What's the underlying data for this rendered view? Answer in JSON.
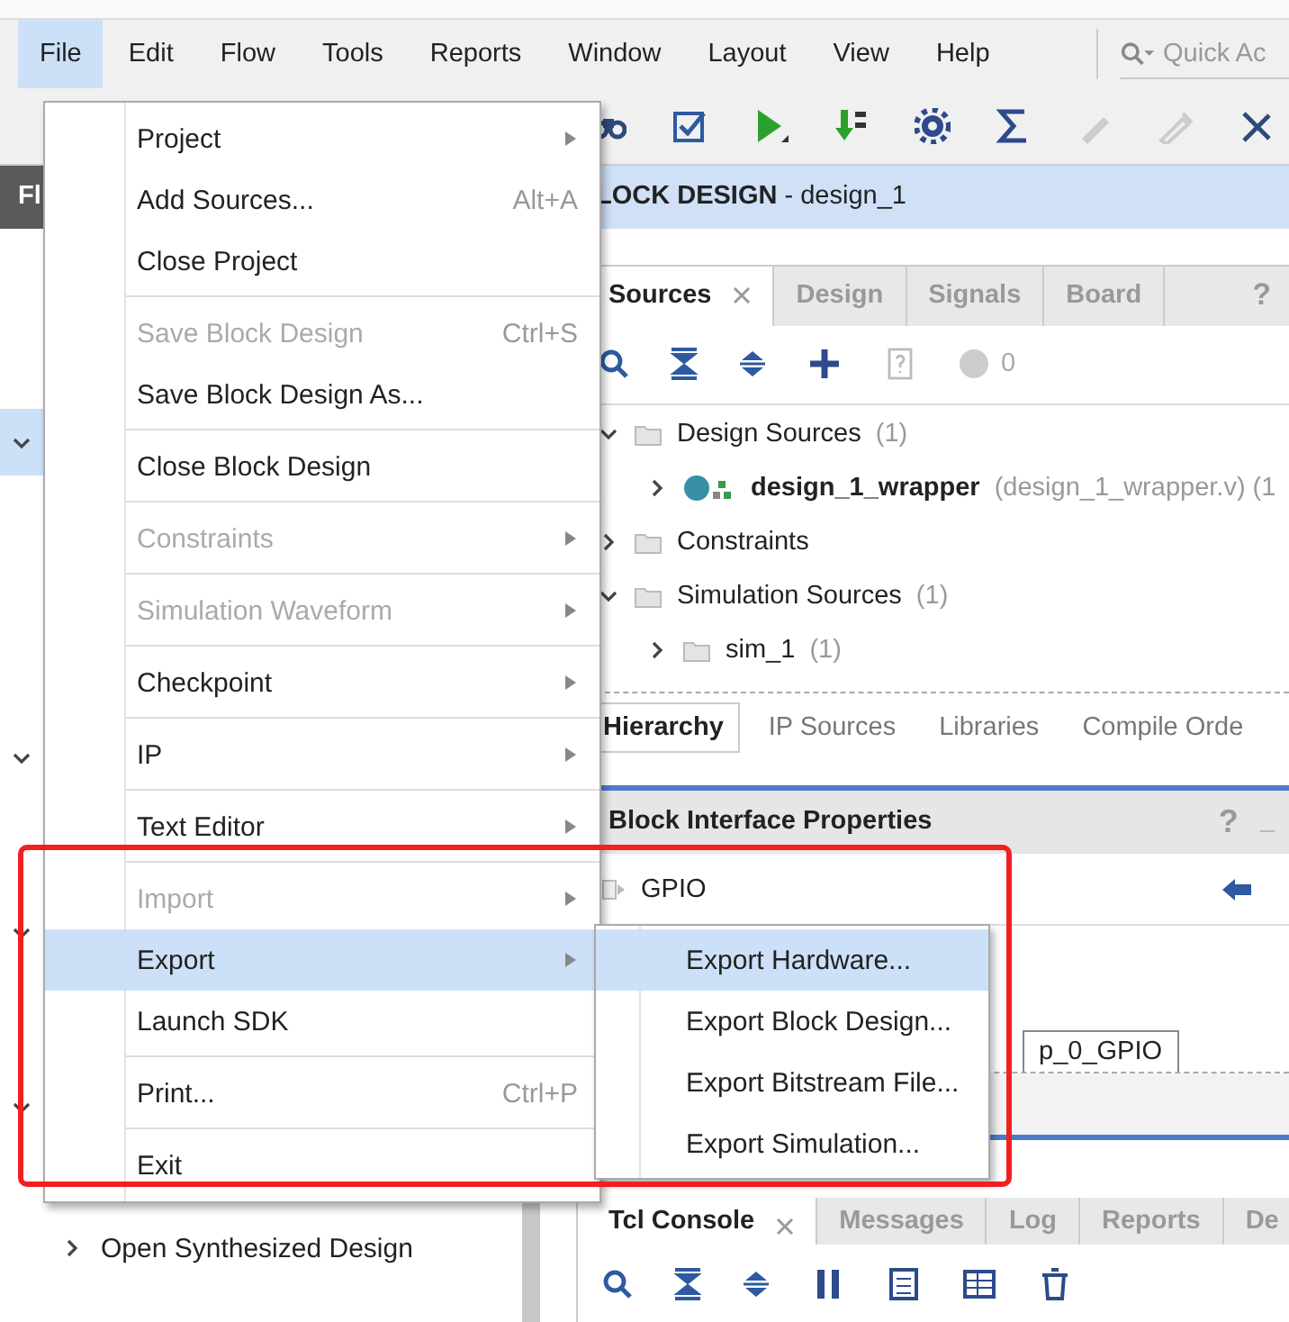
{
  "menubar": {
    "items": [
      {
        "label": "File",
        "selected": true
      },
      {
        "label": "Edit",
        "selected": false
      },
      {
        "label": "Flow",
        "selected": false
      },
      {
        "label": "Tools",
        "selected": false
      },
      {
        "label": "Reports",
        "selected": false
      },
      {
        "label": "Window",
        "selected": false
      },
      {
        "label": "Layout",
        "selected": false
      },
      {
        "label": "View",
        "selected": false
      },
      {
        "label": "Help",
        "selected": false
      }
    ],
    "quick_access": {
      "placeholder": "Quick Ac"
    }
  },
  "left_panel": {
    "header": "Fl",
    "rows": [
      {
        "selected": true
      },
      {
        "selected": false
      },
      {
        "selected": false
      },
      {
        "selected": false
      }
    ],
    "flow_item": {
      "label": "Open Synthesized Design",
      "expanded": false
    }
  },
  "diagram_header": {
    "title": "**LOCK DESIGN** - design_1"
  },
  "sources_panel": {
    "tabs": [
      {
        "label": "Sources",
        "selected": true
      },
      {
        "label": "Design",
        "selected": false
      },
      {
        "label": "Signals",
        "selected": false
      },
      {
        "label": "Board",
        "selected": false
      }
    ],
    "help": "?",
    "message_count": "0",
    "tree": [
      {
        "kind": "folder",
        "label": "Design Sources",
        "count": "(1)",
        "expanded": true,
        "children": [
          {
            "kind": "module",
            "label": "design_1_wrapper",
            "detail": "(design_1_wrapper.v) (1",
            "expanded": false
          }
        ]
      },
      {
        "kind": "folder",
        "label": "Constraints",
        "expanded": false
      },
      {
        "kind": "folder",
        "label": "Simulation Sources",
        "count": "(1)",
        "expanded": true,
        "children": [
          {
            "kind": "folder",
            "label": "sim_1",
            "count": "(1)",
            "expanded": false
          }
        ]
      }
    ],
    "bottom_tabs": [
      {
        "label": "Hierarchy",
        "selected": true
      },
      {
        "label": "IP Sources",
        "selected": false
      },
      {
        "label": "Libraries",
        "selected": false
      },
      {
        "label": "Compile Orde",
        "selected": false
      }
    ]
  },
  "properties_panel": {
    "title": "Block Interface Properties",
    "help": "?",
    "minimize": "_",
    "item": "GPIO",
    "tab": "p_0_GPIO"
  },
  "console_panel": {
    "tabs": [
      {
        "label": "Tcl Console",
        "selected": true
      },
      {
        "label": "Messages",
        "selected": false
      },
      {
        "label": "Log",
        "selected": false
      },
      {
        "label": "Reports",
        "selected": false
      },
      {
        "label": "De",
        "selected": false
      }
    ]
  },
  "file_menu": [
    {
      "kind": "item",
      "label": "Project",
      "submenu": true,
      "disabled": false,
      "selected": false
    },
    {
      "kind": "item",
      "label": "Add Sources...",
      "shortcut": "Alt+A",
      "submenu": false,
      "disabled": false,
      "selected": false
    },
    {
      "kind": "item",
      "label": "Close Project",
      "submenu": false,
      "disabled": false,
      "selected": false
    },
    {
      "kind": "separator"
    },
    {
      "kind": "item",
      "label": "Save Block Design",
      "shortcut": "Ctrl+S",
      "submenu": false,
      "disabled": true,
      "selected": false
    },
    {
      "kind": "item",
      "label": "Save Block Design As...",
      "submenu": false,
      "disabled": false,
      "selected": false
    },
    {
      "kind": "separator"
    },
    {
      "kind": "item",
      "label": "Close Block Design",
      "submenu": false,
      "disabled": false,
      "selected": false
    },
    {
      "kind": "separator"
    },
    {
      "kind": "item",
      "label": "Constraints",
      "submenu": true,
      "disabled": true,
      "selected": false
    },
    {
      "kind": "separator"
    },
    {
      "kind": "item",
      "label": "Simulation Waveform",
      "submenu": true,
      "disabled": true,
      "selected": false
    },
    {
      "kind": "separator"
    },
    {
      "kind": "item",
      "label": "Checkpoint",
      "submenu": true,
      "disabled": false,
      "selected": false
    },
    {
      "kind": "separator"
    },
    {
      "kind": "item",
      "label": "IP",
      "submenu": true,
      "disabled": false,
      "selected": false
    },
    {
      "kind": "separator"
    },
    {
      "kind": "item",
      "label": "Text Editor",
      "submenu": true,
      "disabled": false,
      "selected": false
    },
    {
      "kind": "separator"
    },
    {
      "kind": "item",
      "label": "Import",
      "submenu": true,
      "disabled": true,
      "selected": false
    },
    {
      "kind": "item",
      "label": "Export",
      "submenu": true,
      "disabled": false,
      "selected": true
    },
    {
      "kind": "item",
      "label": "Launch SDK",
      "submenu": false,
      "disabled": false,
      "selected": false
    },
    {
      "kind": "separator"
    },
    {
      "kind": "item",
      "label": "Print...",
      "shortcut": "Ctrl+P",
      "submenu": false,
      "disabled": false,
      "selected": false
    },
    {
      "kind": "separator"
    },
    {
      "kind": "item",
      "label": "Exit",
      "submenu": false,
      "disabled": false,
      "selected": false
    }
  ],
  "export_submenu": [
    {
      "label": "Export Hardware...",
      "selected": true
    },
    {
      "label": "Export Block Design...",
      "selected": false
    },
    {
      "label": "Export Bitstream File...",
      "selected": false
    },
    {
      "label": "Export Simulation...",
      "selected": false
    }
  ]
}
